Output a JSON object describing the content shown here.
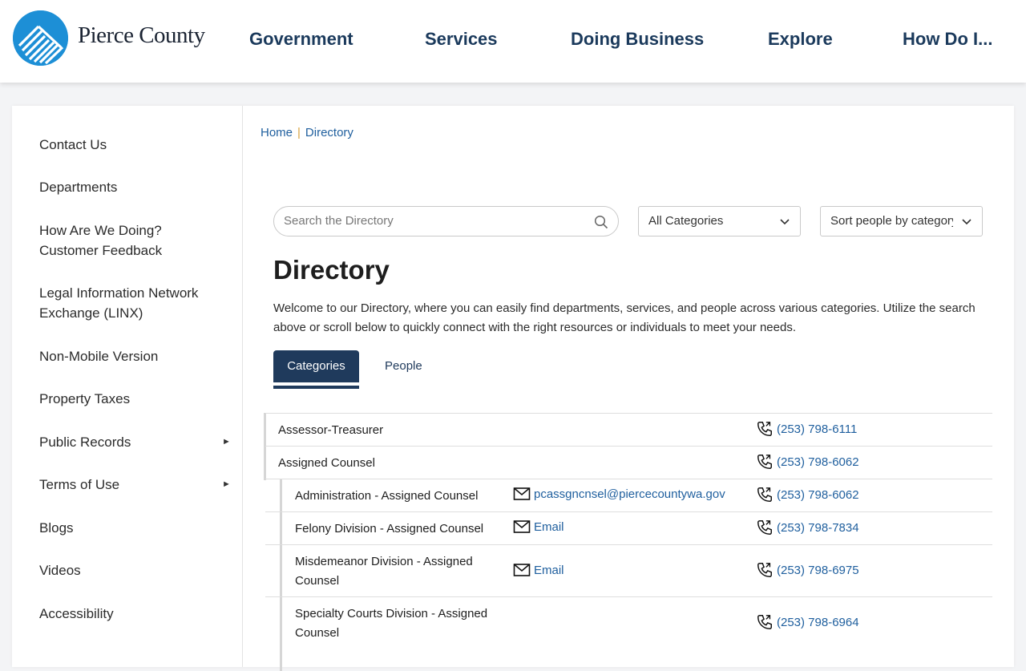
{
  "logo": {
    "text": "Pierce County"
  },
  "nav": [
    "Government",
    "Services",
    "Doing Business",
    "Explore",
    "How Do I..."
  ],
  "sidebar": {
    "items": [
      {
        "label": "Contact Us",
        "has_submenu": false
      },
      {
        "label": "Departments",
        "has_submenu": false
      },
      {
        "label": "How Are We Doing? Customer Feedback",
        "has_submenu": false
      },
      {
        "label": "Legal Information Network Exchange (LINX)",
        "has_submenu": false
      },
      {
        "label": "Non-Mobile Version",
        "has_submenu": false
      },
      {
        "label": "Property Taxes",
        "has_submenu": false
      },
      {
        "label": "Public Records",
        "has_submenu": true
      },
      {
        "label": "Terms of Use",
        "has_submenu": true
      },
      {
        "label": "Blogs",
        "has_submenu": false
      },
      {
        "label": "Videos",
        "has_submenu": false
      },
      {
        "label": "Accessibility",
        "has_submenu": false
      }
    ],
    "arrow_glyph": "►"
  },
  "breadcrumb": {
    "home": "Home",
    "current": "Directory"
  },
  "search": {
    "placeholder": "Search the Directory"
  },
  "filters": {
    "category": "All Categories",
    "sort": "Sort people by category"
  },
  "page": {
    "title": "Directory",
    "intro": "Welcome to our Directory, where you can easily find departments, services, and people across various categories. Utilize the search above or scroll below to quickly connect with the right resources or individuals to meet your needs."
  },
  "tabs": {
    "active": "Categories",
    "other": "People"
  },
  "directory": [
    {
      "name": "Assessor-Treasurer",
      "email": "",
      "phone": "(253) 798-6111"
    },
    {
      "name": "Assigned Counsel",
      "email": "",
      "phone": "(253) 798-6062"
    },
    {
      "name": "Administration - Assigned Counsel",
      "email": "pcassgncnsel@piercecountywa.gov",
      "phone": "(253) 798-6062"
    },
    {
      "name": "Felony Division - Assigned Counsel",
      "email": "Email",
      "phone": "(253) 798-7834"
    },
    {
      "name": "Misdemeanor Division - Assigned Counsel",
      "email": "Email",
      "phone": "(253) 798-6975"
    },
    {
      "name": "Specialty Courts Division - Assigned Counsel",
      "email": "",
      "phone": "(253) 798-6964"
    }
  ],
  "colors": {
    "brand_blue": "#1d8fd6",
    "nav_text": "#1b3a5c",
    "link": "#1f5f9e",
    "tab_active": "#1f3a5c",
    "crumb_separator": "#d8a23d"
  }
}
